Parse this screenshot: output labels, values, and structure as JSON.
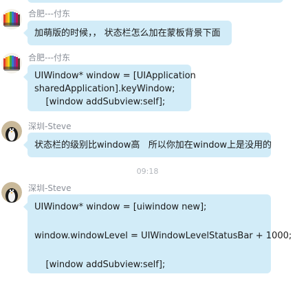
{
  "messages": [
    {
      "sender": "合肥---付东",
      "lines": [
        "加萌版的时候，， 状态栏怎么加在蒙板背景下面"
      ]
    },
    {
      "sender": "合肥---付东",
      "lines": [
        "UIWindow* window = [UIApplication",
        "sharedApplication].keyWindow;",
        "    [window addSubview:self];"
      ]
    },
    {
      "sender": "深圳-Steve",
      "lines": [
        "状态栏的级别比window高   所以你加在window上是没用的"
      ]
    },
    {
      "timestamp": "09:18"
    },
    {
      "sender": "深圳-Steve",
      "lines": [
        "UIWindow* window = [uiwindow new];",
        "",
        "window.windowLevel = UIWindowLevelStatusBar + 1000;",
        "",
        "    [window addSubview:self];"
      ]
    }
  ],
  "colors": {
    "bubble": "#d2ecf8",
    "sender_name": "#8a8f98",
    "timestamp": "#b0b4ba"
  }
}
